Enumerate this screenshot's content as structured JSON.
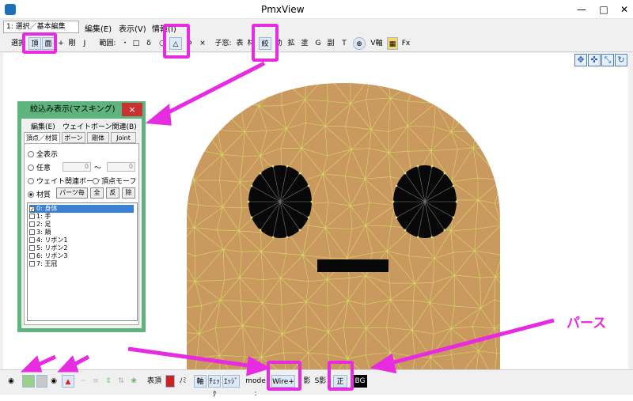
{
  "window": {
    "title": "PmxView"
  },
  "menubar": {
    "mode_select": "1: 選択／基本編集",
    "items": [
      "編集(E)",
      "表示(V)",
      "情報(I)"
    ]
  },
  "toolbar": {
    "items": [
      "選択",
      "頂",
      "面",
      "+",
      "剛",
      "J",
      "範囲:",
      "・",
      "□",
      "δ",
      "○",
      "△",
      "Φ",
      "×",
      "子窓:",
      "表",
      "材",
      "絞",
      "動",
      "拡",
      "塗",
      "G",
      "副",
      "T",
      "V軸",
      "Fx"
    ]
  },
  "panel": {
    "title": "絞込み表示(マスキング)",
    "close": "×",
    "menu": [
      "編集(E)",
      "ウェイトボーン関連(B)"
    ],
    "tabs": [
      "頂点／材質",
      "ボーン",
      "剛体",
      "Joint"
    ],
    "radios": [
      "全表示",
      "任意",
      "ウェイト関連ボーン",
      "頂点モーフ",
      "材質"
    ],
    "range_from": "0",
    "range_sep": "～",
    "range_to": "0",
    "buttons": [
      "パーツ毎",
      "全",
      "反",
      "除"
    ],
    "list": [
      "0: 身体",
      "1: 手",
      "2: 足",
      "3: 頬",
      "4: リボン1",
      "5: リボン2",
      "6: リボン3",
      "7: 王冠"
    ]
  },
  "bottombar": {
    "items": [
      "表頂",
      "ﾉﾐ",
      "軸",
      "ﾁｪｯｸ",
      "ｴｯｼﾞ",
      "mode :",
      "Wire+",
      "影",
      "S影",
      "正",
      "BG"
    ]
  },
  "annotation": {
    "label": "パース",
    "color": "#e62be0"
  },
  "colors": {
    "face": "#c9995f",
    "wire": "#d9e36a",
    "highlight": "#e62be0",
    "panel": "#5fb37c"
  }
}
